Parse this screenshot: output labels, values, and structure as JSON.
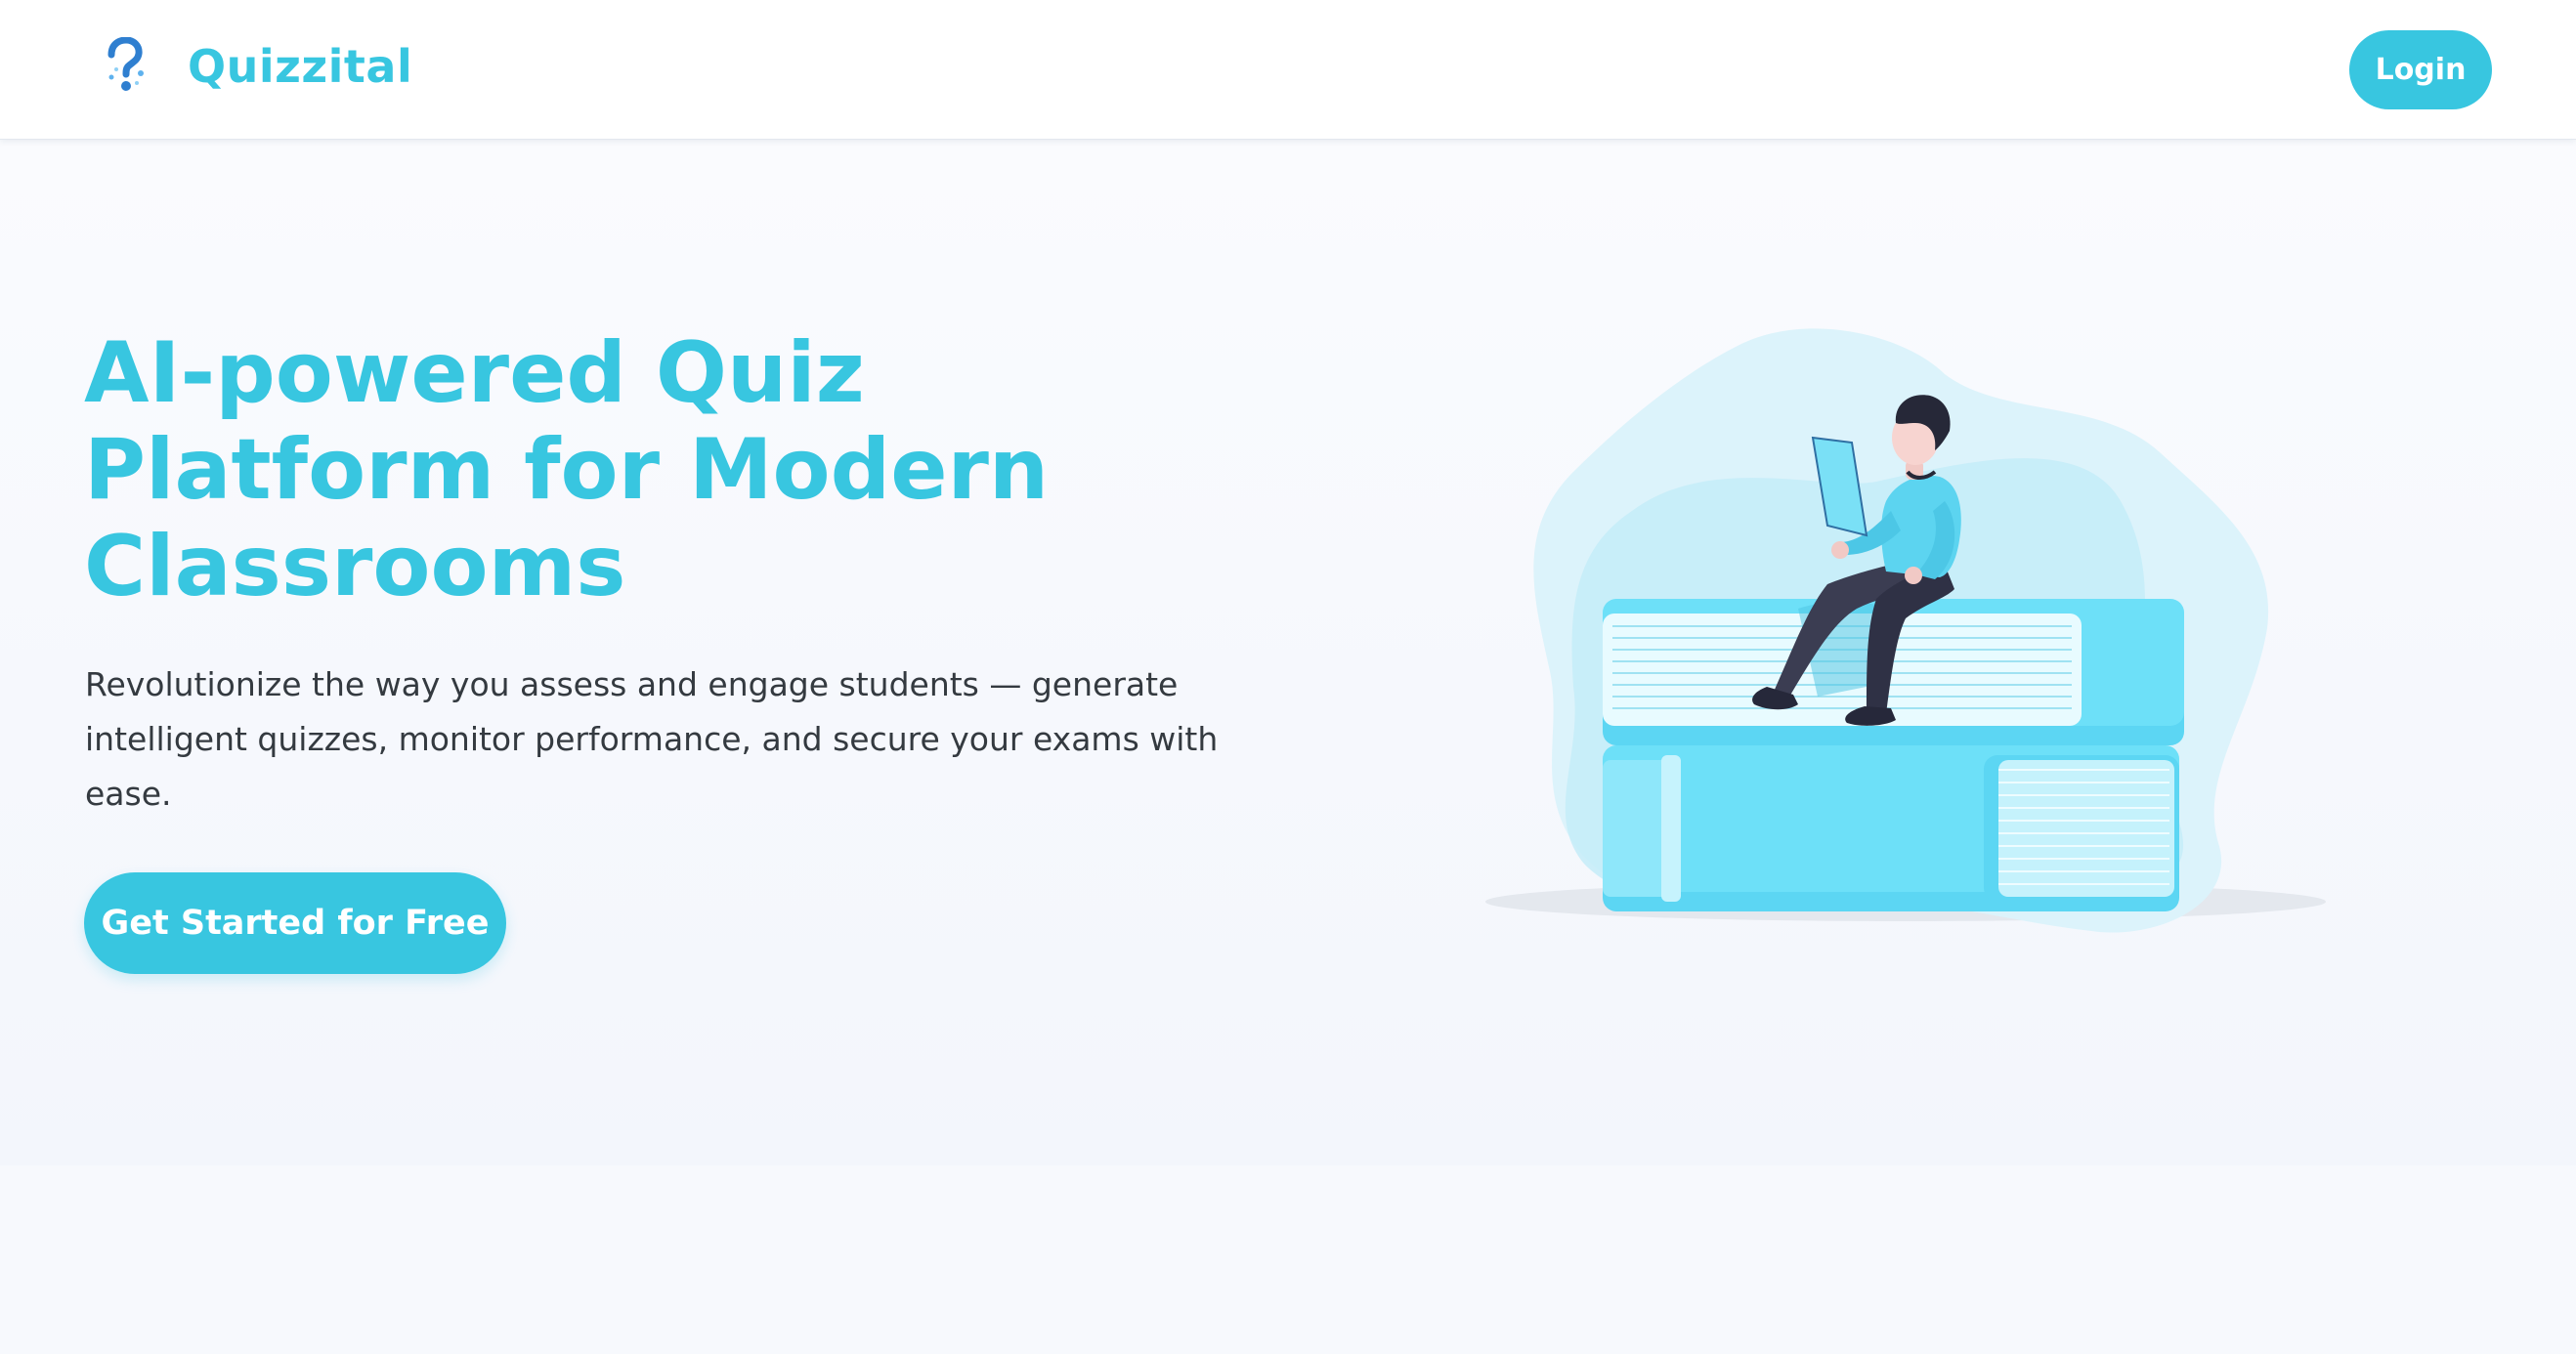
{
  "header": {
    "brand": "Quizzital",
    "login_label": "Login"
  },
  "hero": {
    "title": "AI-powered Quiz Platform for Modern Classrooms",
    "subtitle": "Revolutionize the way you assess and engage students — generate intelligent quizzes, monitor performance, and secure your exams with ease.",
    "cta_label": "Get Started for Free"
  },
  "icons": {
    "logo": "question-mark-icon",
    "illustration": "student-reading-on-books-illustration"
  },
  "colors": {
    "accent": "#38c6e0",
    "text": "#343a40",
    "background": "#f7f9fd",
    "header_bg": "#ffffff"
  }
}
